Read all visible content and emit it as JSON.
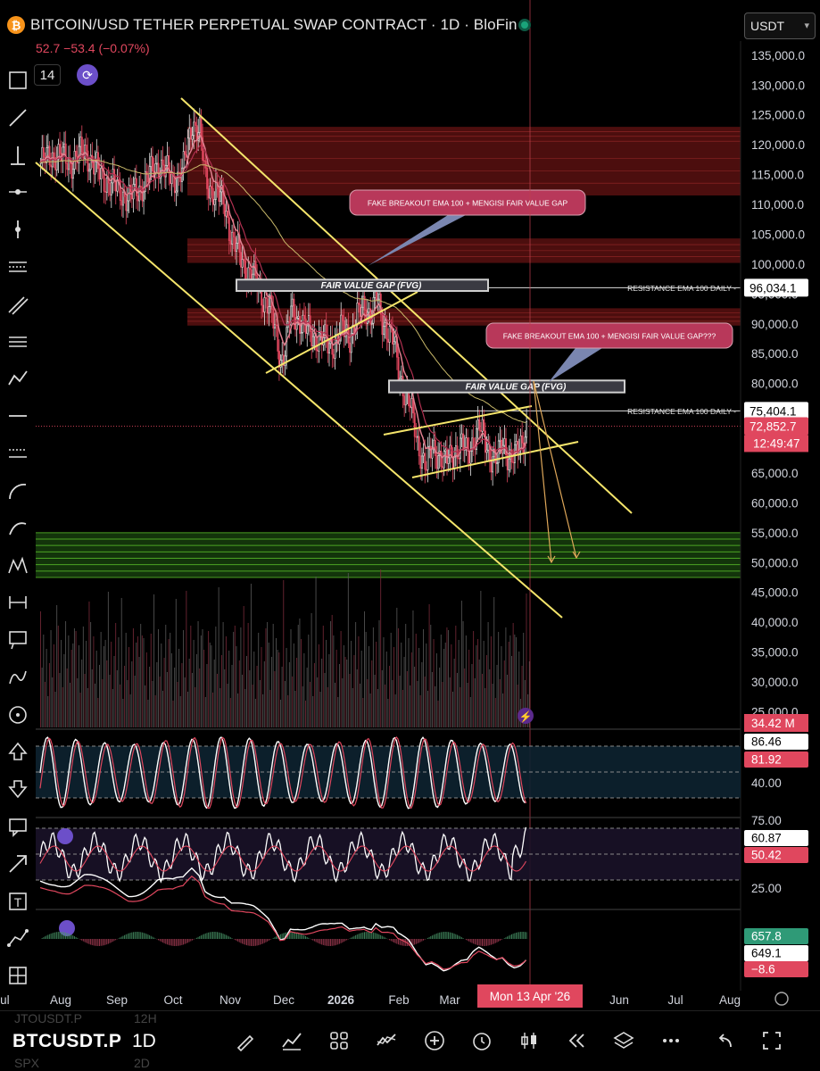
{
  "header": {
    "title": "BITCOIN/USD TETHER PERPETUAL SWAP CONTRACT · 1D · BloFin",
    "change": "52.7  −53.4 (−0.07%)",
    "interval_badge": "14",
    "currency_selector": "USDT",
    "btc_symbol": "₿"
  },
  "bottom_bar": {
    "symbol": "BTCUSDT.P",
    "timeframe": "1D",
    "ghost_symbol_top": "JTOUSDT.P",
    "ghost_symbol_bottom": "SPX",
    "ghost_tf_top": "12H",
    "ghost_tf_bottom": "2D",
    "icons": [
      "pen-icon",
      "chart-type-icon",
      "layouts-icon",
      "indicators-icon",
      "add-icon",
      "alert-icon",
      "candles-icon",
      "replay-icon",
      "layers-icon",
      "more-icon",
      "undo-icon",
      "fullscreen-icon"
    ]
  },
  "left_toolbar": {
    "icons": [
      "crosshair-icon",
      "trendline-icon",
      "vertical-line-icon",
      "ray-icon",
      "cross-line-icon",
      "fib-icon",
      "parallel-channel-icon",
      "regression-icon",
      "zigzag-icon",
      "horizontal-line-icon",
      "fib-channel-icon",
      "arc-icon",
      "brush-icon",
      "pattern-icon",
      "measure-icon",
      "callout-icon",
      "path-icon",
      "circle-icon",
      "arrow-up-icon",
      "arrow-down-icon",
      "comment-icon",
      "arrow-icon",
      "text-icon",
      "polyline-icon",
      "range-icon"
    ]
  },
  "chart_data": {
    "type": "candlestick",
    "symbol": "BTCUSDT.P",
    "interval": "1D",
    "ylim": [
      22000,
      136000
    ],
    "y_ticks": [
      25000,
      30000,
      35000,
      40000,
      45000,
      50000,
      55000,
      60000,
      65000,
      70000,
      75000,
      80000,
      85000,
      90000,
      95000,
      100000,
      105000,
      110000,
      115000,
      120000,
      125000,
      130000,
      135000
    ],
    "y_tick_labels": [
      "25,000.0",
      "30,000.0",
      "35,000.0",
      "40,000.0",
      "45,000.0",
      "50,000.0",
      "55,000.0",
      "60,000.0",
      "65,000.0",
      "70,000.0",
      "75,000.0",
      "80,000.0",
      "85,000.0",
      "90,000.0",
      "95,000.0",
      "100,000.0",
      "105,000.0",
      "110,000.0",
      "115,000.0",
      "120,000.0",
      "125,000.0",
      "130,000.0",
      "135,000.0"
    ],
    "x_tick_labels": [
      "Jul",
      "Aug",
      "Sep",
      "Oct",
      "Nov",
      "Dec",
      "2026",
      "Feb",
      "Mar",
      "Mon 13 Apr '26",
      "Jun",
      "Jul",
      "Aug"
    ],
    "cursor_date": "Mon 13 Apr '26",
    "price_path": [
      [
        0,
        117000
      ],
      [
        10,
        118500
      ],
      [
        20,
        117000
      ],
      [
        30,
        119000
      ],
      [
        40,
        115000
      ],
      [
        50,
        113000
      ],
      [
        60,
        111000
      ],
      [
        70,
        113500
      ],
      [
        80,
        117000
      ],
      [
        90,
        114000
      ],
      [
        97,
        116000
      ],
      [
        103,
        124000
      ],
      [
        108,
        122000
      ],
      [
        112,
        114000
      ],
      [
        118,
        112000
      ],
      [
        125,
        110000
      ],
      [
        130,
        104000
      ],
      [
        135,
        101500
      ],
      [
        140,
        99000
      ],
      [
        145,
        97500
      ],
      [
        150,
        95000
      ],
      [
        155,
        93000
      ],
      [
        160,
        88000
      ],
      [
        163,
        84000
      ],
      [
        166,
        85500
      ],
      [
        170,
        92000
      ],
      [
        175,
        91000
      ],
      [
        180,
        89000
      ],
      [
        185,
        88000
      ],
      [
        190,
        87500
      ],
      [
        195,
        86500
      ],
      [
        200,
        87000
      ],
      [
        205,
        89000
      ],
      [
        210,
        88000
      ],
      [
        215,
        91000
      ],
      [
        220,
        93000
      ],
      [
        225,
        91500
      ],
      [
        228,
        94500
      ],
      [
        232,
        90500
      ],
      [
        236,
        89000
      ],
      [
        240,
        86500
      ],
      [
        243,
        82000
      ],
      [
        247,
        79000
      ],
      [
        250,
        77000
      ],
      [
        253,
        73500
      ],
      [
        256,
        70000
      ],
      [
        259,
        68000
      ],
      [
        262,
        66000
      ],
      [
        266,
        69000
      ],
      [
        270,
        68500
      ],
      [
        274,
        66500
      ],
      [
        278,
        67500
      ],
      [
        282,
        69000
      ],
      [
        286,
        69500
      ],
      [
        290,
        68000
      ],
      [
        294,
        71000
      ],
      [
        298,
        72500
      ],
      [
        302,
        70000
      ],
      [
        306,
        68000
      ],
      [
        310,
        67000
      ],
      [
        314,
        70000
      ],
      [
        318,
        68000
      ],
      [
        322,
        67500
      ],
      [
        326,
        69500
      ],
      [
        330,
        72852.7
      ]
    ],
    "price_labels": [
      {
        "value": 96034.1,
        "label": "96,034.1",
        "style": "white"
      },
      {
        "value": 75404.1,
        "label": "75,404.1",
        "style": "white"
      },
      {
        "value": 72852.7,
        "label": "72,852.7",
        "style": "red"
      }
    ],
    "countdown": "12:49:47",
    "volume_label": "34.42 M",
    "resistance_levels": [
      {
        "value": 96034.1,
        "text": "RESISTANCE EMA 100 DAILY -"
      },
      {
        "value": 75404.1,
        "text": "RESISTANCE EMA 100 DAILY -"
      }
    ],
    "supply_zones": [
      [
        119800,
        123000
      ],
      [
        111500,
        119800
      ],
      [
        100200,
        104300
      ],
      [
        89700,
        92600
      ]
    ],
    "demand_zones": [
      [
        47500,
        55000
      ]
    ],
    "fvg_boxes": [
      {
        "text": "FAIR VALUE GAP (FVG)",
        "top": 97400,
        "bottom": 95500
      },
      {
        "text": "FAIR VALUE GAP (FVG)",
        "top": 80500,
        "bottom": 78500
      }
    ],
    "callouts": [
      {
        "text": "FAKE BREAKOUT EMA 100 + MENGISI FAIR VALUE GAP"
      },
      {
        "text": "FAKE BREAKOUT EMA 100 + MENGISI FAIR VALUE GAP???"
      }
    ],
    "stoch": {
      "labels": [
        "86.46",
        "81.92",
        "40.00"
      ],
      "ticks": [
        "40.00"
      ]
    },
    "rsi": {
      "labels": [
        "60.87",
        "50.42",
        "25.00",
        "75.00"
      ],
      "ticks": [
        "75.00",
        "25.00"
      ]
    },
    "macd": {
      "labels": [
        "657.8",
        "649.1",
        "−8.6"
      ]
    }
  },
  "colors": {
    "up": "#e6e6e6",
    "down": "#e0475e",
    "channel": "#f5e56b",
    "supply": "#8b1a1a",
    "demand": "#2e7d1a",
    "callout": "#b8385a",
    "macd_fast": "#ffffff",
    "ema": "#c9b96a"
  }
}
